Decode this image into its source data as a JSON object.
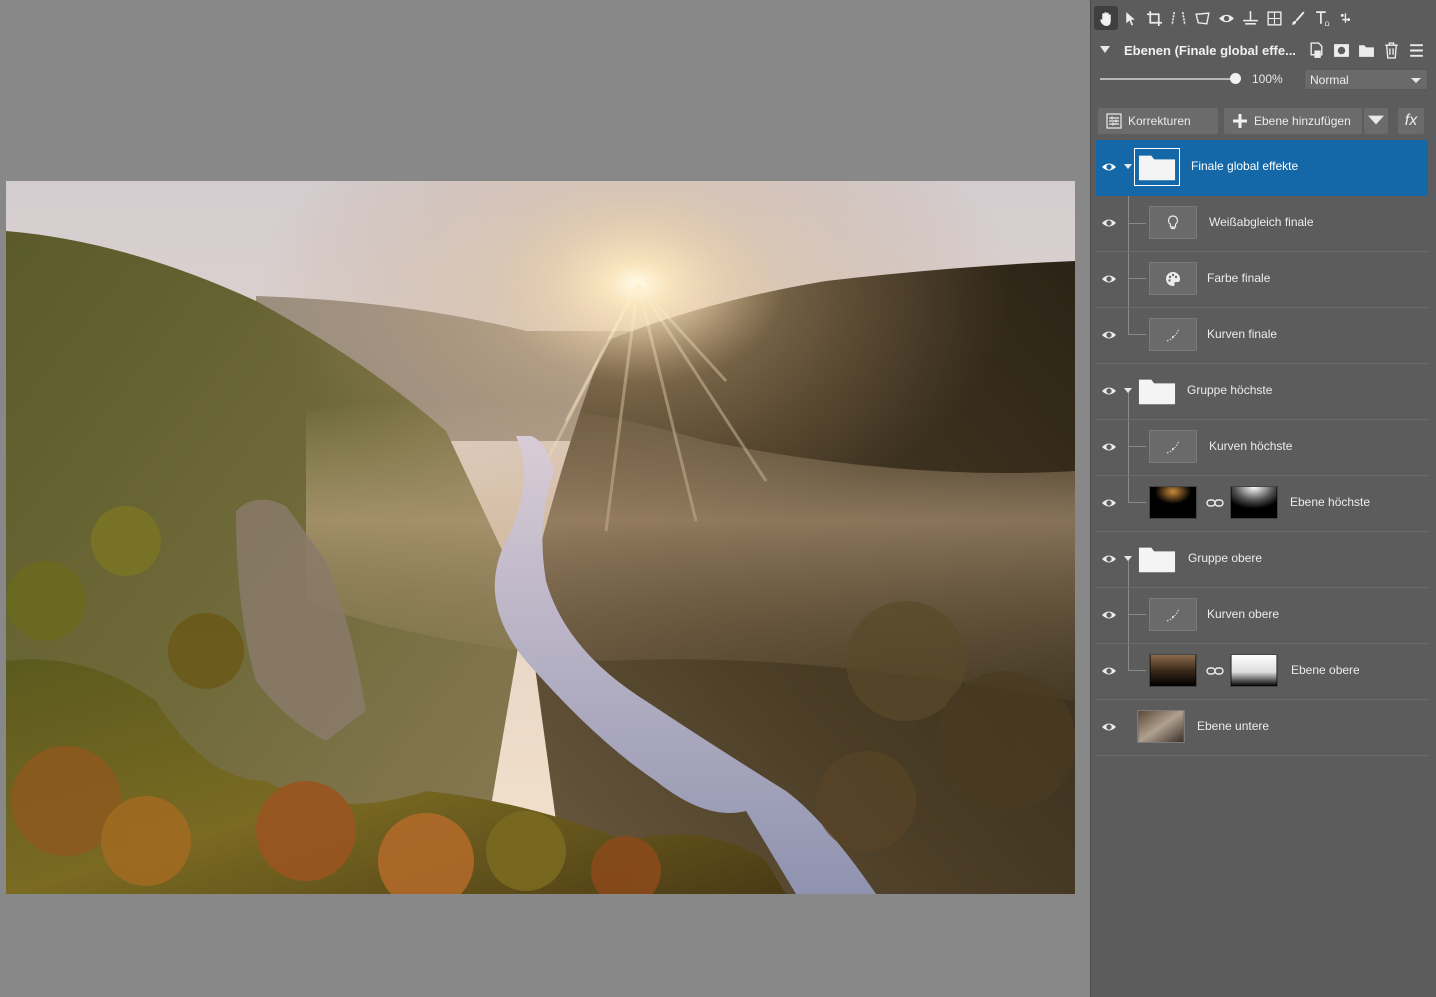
{
  "toolbar": {
    "tools": [
      "hand-icon",
      "pointer-icon",
      "crop-icon",
      "perspective-icon",
      "transform-icon",
      "redeye-icon",
      "straighten-icon",
      "grid-icon",
      "brush-icon",
      "text-icon",
      "more-tools-icon"
    ]
  },
  "layers": {
    "title": "Ebenen (Finale global effe...",
    "opacity": "100%",
    "blend_mode": "Normal",
    "corrections_label": "Korrekturen",
    "add_layer_label": "Ebene hinzufügen",
    "fx_label": "fx"
  },
  "layer_list": [
    {
      "name": "Finale global effekte",
      "type": "group",
      "selected": true
    },
    {
      "name": "Weißabgleich finale",
      "type": "whitebalance"
    },
    {
      "name": "Farbe finale",
      "type": "color"
    },
    {
      "name": "Kurven finale",
      "type": "curves"
    },
    {
      "name": "Gruppe höchste",
      "type": "group"
    },
    {
      "name": "Kurven höchste",
      "type": "curves"
    },
    {
      "name": "Ebene höchste",
      "type": "image-mask"
    },
    {
      "name": "Gruppe obere",
      "type": "group"
    },
    {
      "name": "Kurven obere",
      "type": "curves"
    },
    {
      "name": "Ebene obere",
      "type": "image-mask"
    },
    {
      "name": "Ebene untere",
      "type": "image"
    }
  ],
  "colors": {
    "panel_bg": "#5c5c5c",
    "canvas_bg": "#888888",
    "selection": "#1468a8"
  }
}
